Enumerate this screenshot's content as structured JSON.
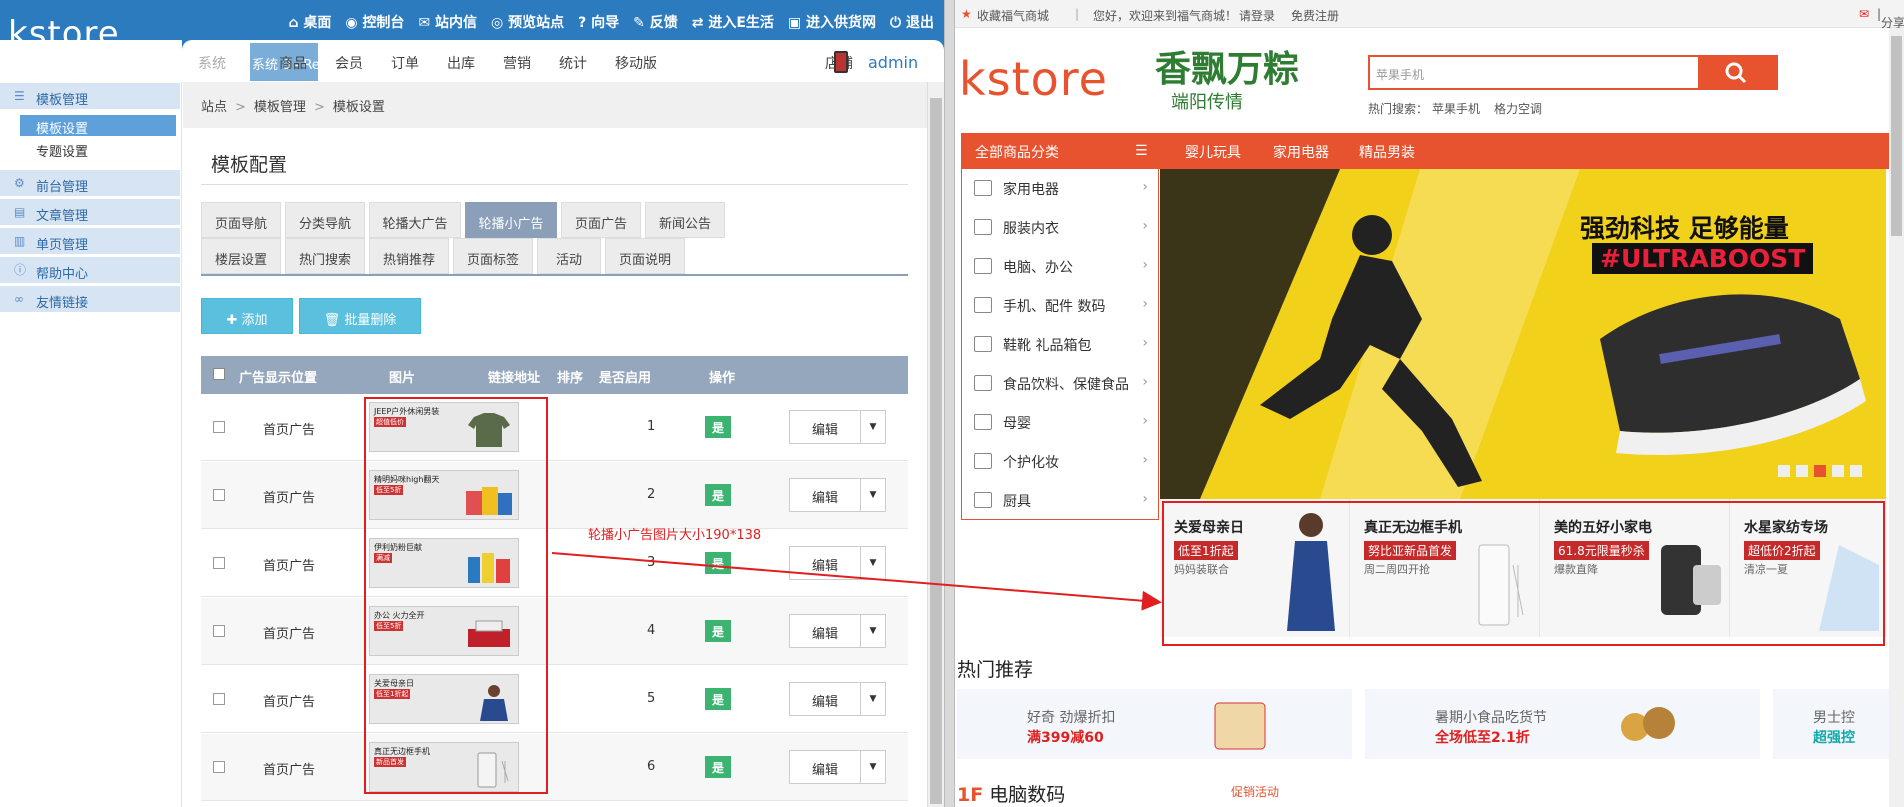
{
  "admin": {
    "logo": "kstore",
    "top_links": [
      "桌面",
      "控制台",
      "站内信",
      "预览站点",
      "向导",
      "反馈",
      "进入E生活",
      "进入供货网",
      "退出"
    ],
    "nav_release": "系统 0 - Release",
    "nav_items": [
      "商品",
      "会员",
      "订单",
      "出库",
      "营销",
      "统计",
      "移动版",
      "店铺"
    ],
    "user": "admin",
    "sidebar": {
      "sections": [
        "模板管理",
        "前台管理",
        "文章管理",
        "单页管理",
        "帮助中心",
        "友情链接"
      ],
      "subitems": [
        "模板设置",
        "专题设置"
      ]
    },
    "breadcrumb": [
      "站点",
      "模板管理",
      "模板设置"
    ],
    "page_title": "模板配置",
    "tabs_row1": [
      "页面导航",
      "分类导航",
      "轮播大广告",
      "轮播小广告",
      "页面广告",
      "新闻公告"
    ],
    "tabs_row2": [
      "楼层设置",
      "热门搜索",
      "热销推荐",
      "页面标签",
      "活动",
      "页面说明"
    ],
    "active_tab": "轮播小广告",
    "btn_add": "添加",
    "btn_batch_delete": "批量删除",
    "table_headers": [
      "广告显示位置",
      "图片",
      "链接地址",
      "排序",
      "是否启用",
      "操作"
    ],
    "rows": [
      {
        "position": "首页广告",
        "img_title": "JEEP户外休闲男装",
        "img_tag": "超值低价",
        "sort": "1",
        "enabled": "是",
        "action": "编辑"
      },
      {
        "position": "首页广告",
        "img_title": "精明妈咪high翻天",
        "img_tag": "低至5折",
        "sort": "2",
        "enabled": "是",
        "action": "编辑"
      },
      {
        "position": "首页广告",
        "img_title": "伊利奶粉巨献",
        "img_tag": "满减",
        "sort": "3",
        "enabled": "是",
        "action": "编辑"
      },
      {
        "position": "首页广告",
        "img_title": "办公 火力全开",
        "img_tag": "低至5折",
        "sort": "4",
        "enabled": "是",
        "action": "编辑"
      },
      {
        "position": "首页广告",
        "img_title": "关爱母亲日",
        "img_tag": "低至1折起",
        "sort": "5",
        "enabled": "是",
        "action": "编辑"
      },
      {
        "position": "首页广告",
        "img_title": "真正无边框手机",
        "img_tag": "新品首发",
        "sort": "6",
        "enabled": "是",
        "action": "编辑"
      }
    ],
    "annotation": "轮播小广告图片大小190*138"
  },
  "store": {
    "top_left": [
      "收藏福气商城",
      "您好，欢迎来到福气商城！",
      "请登录",
      "免费注册"
    ],
    "top_right": "分享",
    "logo": "kstore",
    "brand_line1": "香飘万粽",
    "brand_line2": "端阳传情",
    "search_placeholder": "苹果手机",
    "hot_search_label": "热门搜索：",
    "hot_search_items": [
      "苹果手机",
      "格力空调"
    ],
    "nav_all": "全部商品分类",
    "nav_items": [
      "婴儿玩具",
      "家用电器",
      "精品男装"
    ],
    "categories": [
      "家用电器",
      "服装内衣",
      "电脑、办公",
      "手机、配件  数码",
      "鞋靴  礼品箱包",
      "食品饮料、保健食品",
      "母婴",
      "个护化妆",
      "厨具"
    ],
    "banner_line1": "强劲科技 足够能量",
    "banner_line2": "#ULTRABOOST",
    "small_ads": [
      {
        "title": "关爱母亲日",
        "tag": "低至1折起",
        "sub": "妈妈装联合"
      },
      {
        "title": "真正无边框手机",
        "tag": "努比亚新品首发",
        "sub": "周二周四开抢"
      },
      {
        "title": "美的五好小家电",
        "tag": "61.8元限量秒杀",
        "sub": "爆款直降"
      },
      {
        "title": "水星家纺专场",
        "tag": "超低价2折起",
        "sub": "清凉一夏"
      }
    ],
    "hot_title": "热门推荐",
    "hot_cards": [
      {
        "title": "好奇 劲爆折扣",
        "sub": "满399减60"
      },
      {
        "title": "暑期小食品吃货节",
        "sub": "全场低至2.1折"
      },
      {
        "title": "男士控",
        "sub": "超强控"
      }
    ],
    "floor_num": "1F",
    "floor_title": "电脑数码",
    "promo": "促销活动",
    "colors": {
      "accent": "#e8532f",
      "admin_blue": "#2d7bbf",
      "annotation": "#e02020"
    }
  }
}
